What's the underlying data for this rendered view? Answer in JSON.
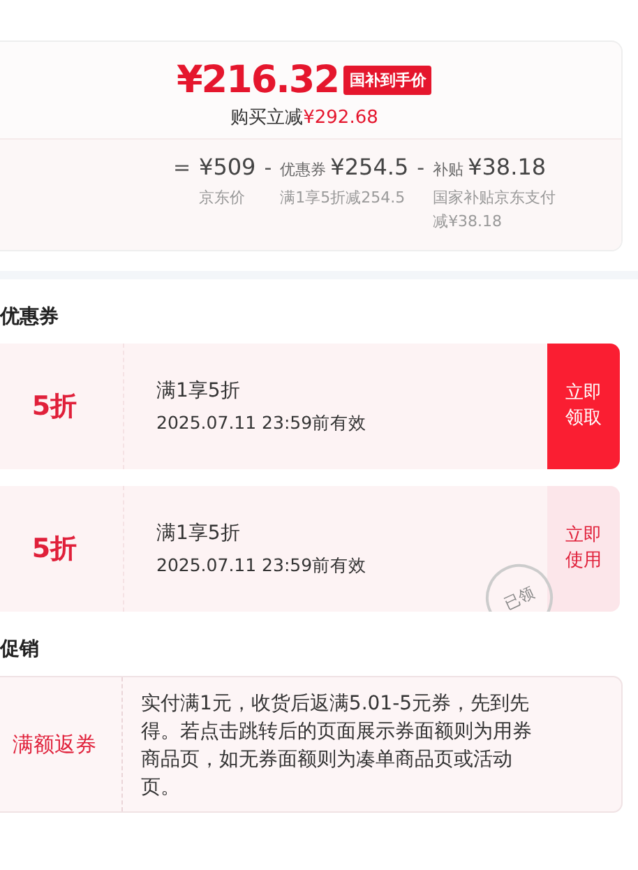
{
  "price_card": {
    "price": "¥216.32",
    "badge": "国补到手价",
    "saving_label": "购买立减",
    "saving": "¥292.68",
    "breakdown": [
      {
        "operator": "=",
        "amount": "¥509",
        "note": "京东价"
      },
      {
        "operator": "-",
        "prefix": "优惠券",
        "amount": "¥254.5",
        "note": "满1享5折减254.5"
      },
      {
        "operator": "-",
        "prefix": "补贴",
        "amount": "¥38.18",
        "note": "国家补贴京东支付减¥38.18"
      }
    ]
  },
  "coupons": {
    "title": "优惠券",
    "items": [
      {
        "value": "5折",
        "condition": "满1享5折",
        "expiry": "2025.07.11 23:59前有效",
        "action": "立即领取",
        "claimed": false
      },
      {
        "value": "5折",
        "condition": "满1享5折",
        "expiry": "2025.07.11 23:59前有效",
        "action": "立即使用",
        "claimed": true,
        "stamp": "已领"
      }
    ]
  },
  "promotions": {
    "title": "促销",
    "items": [
      {
        "tag": "满额返券",
        "description": "实付满1元，收货后返满5.01-5元券，先到先得。若点击跳转后的页面展示券面额则为用券商品页，如无券面额则为凑单商品页或活动页。"
      }
    ]
  }
}
